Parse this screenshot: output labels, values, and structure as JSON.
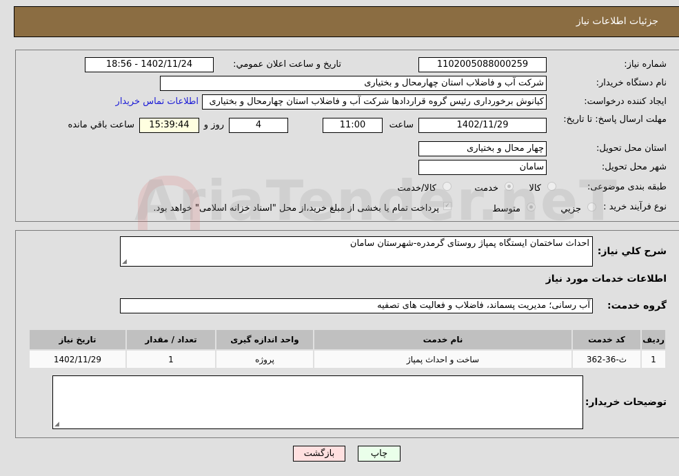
{
  "header": {
    "title": "جزئیات اطلاعات نیاز"
  },
  "form": {
    "need_number": {
      "label": "شماره نیاز:",
      "value": "1102005088000259"
    },
    "announce_datetime": {
      "label": "تاریخ و ساعت اعلان عمومي:",
      "value": "1402/11/24 - 18:56"
    },
    "buyer_org": {
      "label": "نام دستگاه خريدار:",
      "value": "شرکت آب و فاضلاب استان چهارمحال و بختیاری"
    },
    "requester": {
      "label": "ایجاد کننده درخواست:",
      "value": "کیانوش برخورداری رئیس گروه قراردادها شرکت آب و فاضلاب استان چهارمحال و بختیاری",
      "contact_link": "اطلاعات تماس خریدار"
    },
    "deadline": {
      "label": "مهلت ارسال پاسخ: تا تاریخ:",
      "date": "1402/11/29",
      "time_label": "ساعت",
      "time": "11:00",
      "days": "4",
      "days_label": "روز و",
      "remaining": "15:39:44",
      "remaining_label": "ساعت باقي مانده"
    },
    "province": {
      "label": "استان محل تحویل:",
      "value": "چهار محال و بختیاری"
    },
    "city": {
      "label": "شهر محل تحویل:",
      "value": "سامان"
    },
    "category": {
      "label": "طبقه بندی موضوعی:",
      "options": [
        "کالا",
        "خدمت",
        "کالا/خدمت"
      ],
      "selected": "خدمت"
    },
    "purchase_type": {
      "label": "نوع فرآیند خرید :",
      "options": [
        "جزيي",
        "متوسط"
      ],
      "selected": "متوسط",
      "note": "پرداخت تمام یا بخشی از مبلغ خرید،از محل \"اسناد خزانه اسلامی\" خواهد بود."
    }
  },
  "details": {
    "description_label": "شرح کلي نياز:",
    "description": "احداث ساختمان ایستگاه پمپاژ روستای گرمدره-شهرستان سامان",
    "services_title": "اطلاعات خدمات مورد نیاز",
    "service_group_label": "گروه خدمت:",
    "service_group": "آب رسانی؛ مدیریت پسماند، فاضلاب و فعالیت های تصفیه",
    "table": {
      "headers": [
        "ردیف",
        "کد خدمت",
        "نام خدمت",
        "واحد اندازه گیری",
        "تعداد / مقدار",
        "تاریخ نیاز"
      ],
      "rows": [
        [
          "1",
          "ث-36-362",
          "ساخت و احداث پمپاژ",
          "پروژه",
          "1",
          "1402/11/29"
        ]
      ]
    },
    "buyer_notes_label": "توضیحات خریدار:",
    "buyer_notes": ""
  },
  "buttons": {
    "print": "چاپ",
    "back": "بازگشت"
  },
  "watermark": "AriaTender.neT"
}
